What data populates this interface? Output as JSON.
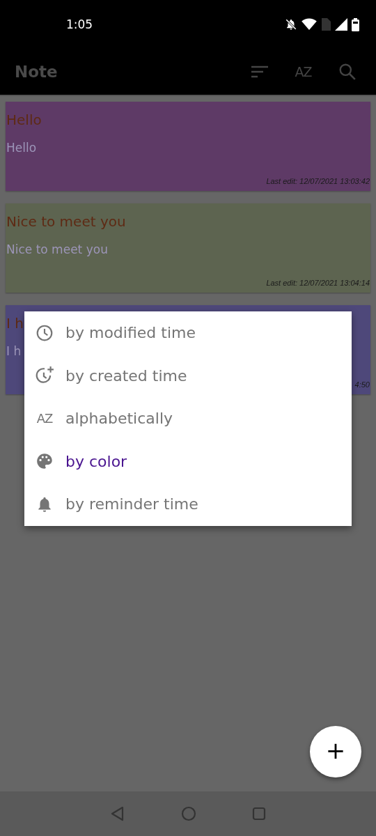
{
  "status_bar": {
    "time": "1:05"
  },
  "toolbar": {
    "title": "Note",
    "actions": [
      {
        "kind": "sort"
      },
      {
        "kind": "az",
        "glyph": "AZ"
      },
      {
        "kind": "search"
      }
    ]
  },
  "notes": [
    {
      "title": "Hello",
      "body": "Hello",
      "last_edit": "Last edit: 12/07/2021 13:03:42",
      "color": "#5e3a66"
    },
    {
      "title": "Nice to meet you",
      "body": "Nice to meet you",
      "last_edit": "Last edit: 12/07/2021 13:04:14",
      "color": "#5d6450"
    },
    {
      "title": "I h",
      "body": "I h",
      "last_edit": "4:50",
      "color": "#4e487a"
    }
  ],
  "sort_menu": [
    {
      "kind": "clock",
      "label": "by modified time",
      "selected": false
    },
    {
      "kind": "clock-plus",
      "label": "by created time",
      "selected": false
    },
    {
      "kind": "az",
      "glyph": "AZ",
      "label": "alphabetically",
      "selected": false
    },
    {
      "kind": "palette",
      "label": "by color",
      "selected": true
    },
    {
      "kind": "bell",
      "label": "by reminder time",
      "selected": false
    }
  ],
  "fab": {
    "label": "+"
  }
}
